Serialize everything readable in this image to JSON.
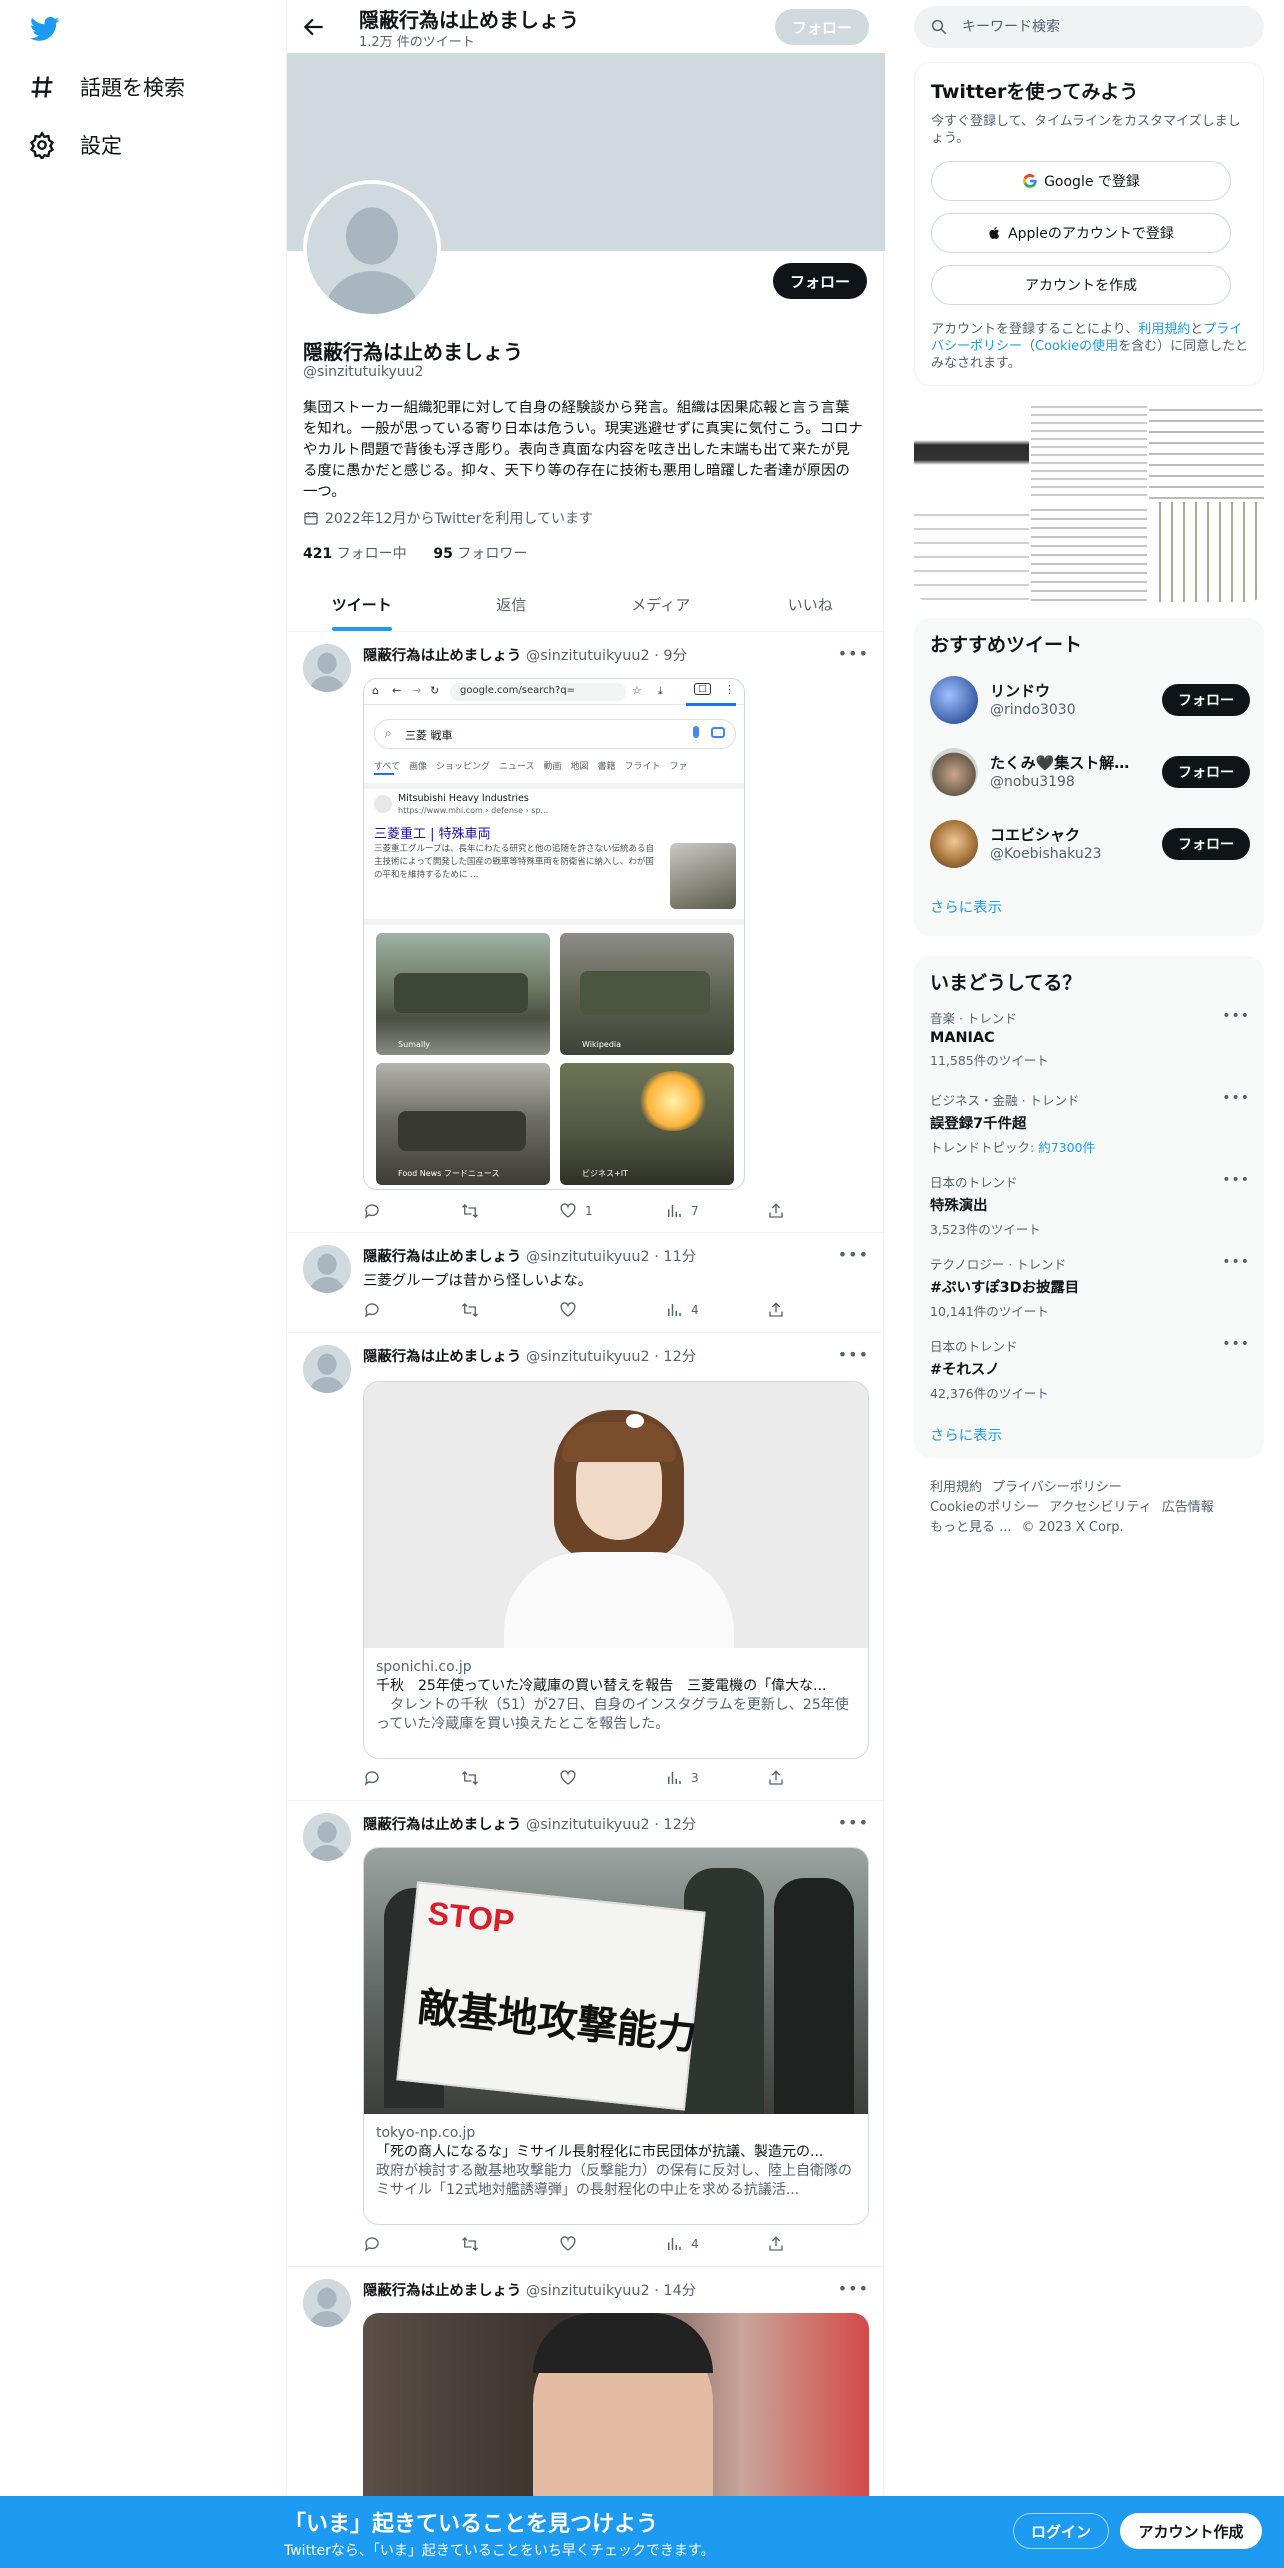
{
  "nav": {
    "explore_label": "話題を検索",
    "settings_label": "設定"
  },
  "profile": {
    "header_name": "隠蔽行為は止めましょう",
    "tweet_count": "1.2万 件のツイート",
    "follow_label": "フォロー",
    "name": "隠蔽行為は止めましょう",
    "handle": "@sinzitutuikyuu2",
    "bio": "集団ストーカー組織犯罪に対して自身の経験談から発言。組織は因果応報と言う言葉を知れ。一般が思っている寄り日本は危うい。現実逃避せずに真実に気付こう。コロナやカルト問題で背後も浮き彫り。表向き真面な内容を呟き出した末端も出て来たが見る度に愚かだと感じる。抑々、天下り等の存在に技術も悪用し暗躍した者達が原因の一つ。",
    "joined": "2022年12月からTwitterを利用しています",
    "following_count": "421",
    "following_label": "フォロー中",
    "followers_count": "95",
    "followers_label": "フォロワー"
  },
  "tabs": [
    {
      "label": "ツイート"
    },
    {
      "label": "返信"
    },
    {
      "label": "メディア"
    },
    {
      "label": "いいね"
    }
  ],
  "tweets": [
    {
      "name": "隠蔽行為は止めましょう",
      "meta": "@sinzitutuikyuu2 · 9分",
      "text": "",
      "views": "7",
      "likes": "1",
      "screenshot": {
        "url": "google.com/search?q=",
        "query": "三菱 戦車",
        "chips": "すべて　画像　ショッピング　ニュース　動画　地図　書籍　フライト　ファ",
        "site": "Mitsubishi Heavy Industries",
        "site_url": "https://www.mhi.com › defense › sp...",
        "result_title": "三菱重工 | 特殊車両",
        "result_desc": "三菱重工グループは、長年にわたる研究と他の追随を許さない伝統ある自主技術によって開発した国産の戦車等特殊車両を防衛省に納入し、わが国の平和を維持するために ...",
        "img1": "Sumally",
        "img2": "Wikipedia",
        "img3": "Food News フードニュース",
        "img4": "ビジネス+IT"
      }
    },
    {
      "name": "隠蔽行為は止めましょう",
      "meta": "@sinzitutuikyuu2 · 11分",
      "text": "三菱グループは昔から怪しいよな。",
      "views": "4"
    },
    {
      "name": "隠蔽行為は止めましょう",
      "meta": "@sinzitutuikyuu2 · 12分",
      "text": "",
      "views": "3",
      "card": {
        "domain": "sponichi.co.jp",
        "title": "千秋　25年使っていた冷蔵庫の買い替えを報告　三菱電機の「偉大な...",
        "desc": "　タレントの千秋（51）が27日、自身のインスタグラムを更新し、25年使っていた冷蔵庫を買い換えたとこを報告した。"
      }
    },
    {
      "name": "隠蔽行為は止めましょう",
      "meta": "@sinzitutuikyuu2 · 12分",
      "text": "",
      "views": "4",
      "card": {
        "domain": "tokyo-np.co.jp",
        "title": "「死の商人になるな」ミサイル長射程化に市民団体が抗議、製造元の...",
        "desc": "政府が検討する敵基地攻撃能力（反撃能力）の保有に反対し、陸上自衛隊のミサイル「12式地対艦誘導弾」の長射程化の中止を求める抗議活...",
        "sign_top": "STOP",
        "sign_text": "敵基地攻撃能力"
      }
    },
    {
      "name": "隠蔽行為は止めましょう",
      "meta": "@sinzitutuikyuu2 · 14分",
      "text": ""
    }
  ],
  "search": {
    "placeholder": "キーワード検索"
  },
  "signup_box": {
    "title": "Twitterを使ってみよう",
    "subtitle": "今すぐ登録して、タイムラインをカスタマイズしましょう。",
    "google": "Google で登録",
    "apple": "Appleのアカウントで登録",
    "create": "アカウントを作成",
    "fine_1": "アカウントを登録することにより、",
    "fine_terms": "利用規約",
    "fine_2": "と",
    "fine_privacy": "プライバシーポリシー",
    "fine_3": "（",
    "fine_cookie": "Cookieの使用",
    "fine_4": "を含む）に同意したとみなされます。"
  },
  "suggested": {
    "title": "おすすめツイート",
    "follow_label": "フォロー",
    "more": "さらに表示",
    "users": [
      {
        "name": "リンドウ",
        "handle": "@rindo3030"
      },
      {
        "name": "たくみ🖤集スト解決…",
        "handle": "@nobu3198"
      },
      {
        "name": "コエビシャク",
        "handle": "@Koebishaku23"
      }
    ]
  },
  "trends": {
    "title": "いまどうしてる？",
    "more": "さらに表示",
    "items": [
      {
        "category": "音楽 · トレンド",
        "title": "MANIAC",
        "count": "11,585件のツイート"
      },
      {
        "category": "ビジネス・金融 · トレンド",
        "title": "誤登録7千件超",
        "count_prefix": "トレンドトピック: ",
        "count_link": "約7300件"
      },
      {
        "category": "日本のトレンド",
        "title": "特殊演出",
        "count": "3,523件のツイート"
      },
      {
        "category": "テクノロジー · トレンド",
        "title": "#ぷいすぽ3Dお披露目",
        "count": "10,141件のツイート"
      },
      {
        "category": "日本のトレンド",
        "title": "#それスノ",
        "count": "42,376件のツイート"
      }
    ]
  },
  "footer": {
    "terms": "利用規約",
    "privacy": "プライバシーポリシー",
    "cookie": "Cookieのポリシー",
    "accessibility": "アクセシビリティ",
    "ads": "広告情報",
    "more": "もっと見る ...",
    "copyright": "© 2023 X Corp."
  },
  "bottom": {
    "title": "「いま」起きていることを見つけよう",
    "subtitle": "Twitterなら、「いま」起きていることをいち早くチェックできます。",
    "login": "ログイン",
    "signup": "アカウント作成"
  },
  "colors": {
    "brand": "#1d9bf0",
    "text": "#0f1419",
    "muted": "#536471",
    "border": "#eff3f4",
    "banner": "#cfd9de"
  }
}
